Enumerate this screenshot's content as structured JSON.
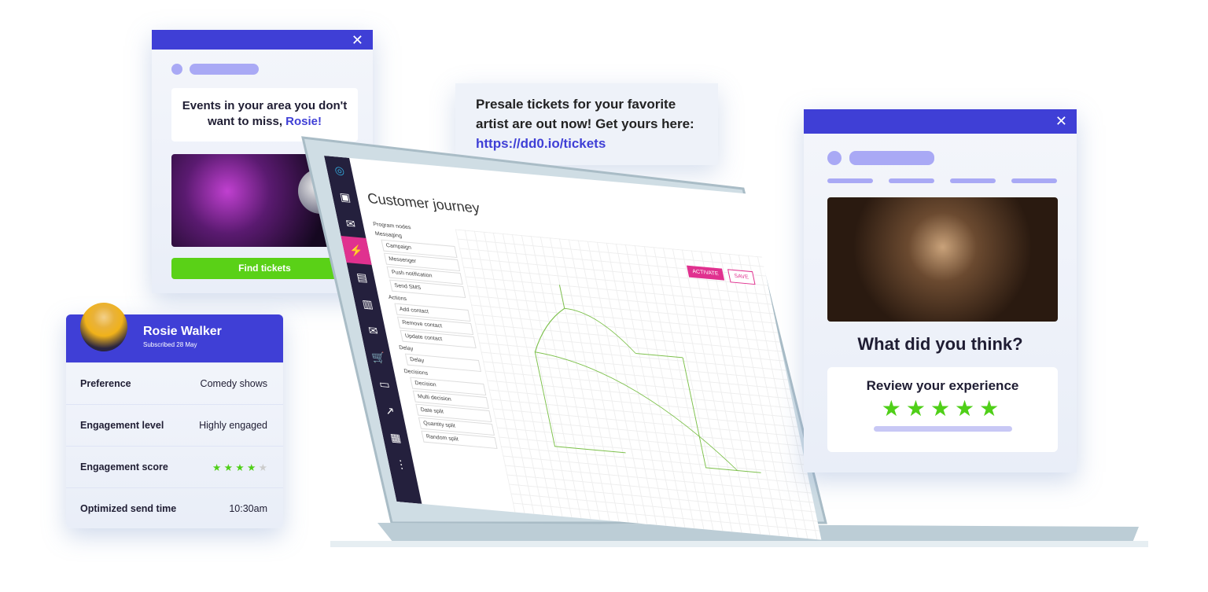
{
  "popup": {
    "message_line1": "Events in your area you don't",
    "message_line2": "want to miss, ",
    "name": "Rosie!",
    "button": "Find tickets",
    "close": "✕"
  },
  "sms": {
    "line1": "Presale tickets for your favorite",
    "line2": "artist are out now! Get yours here:",
    "link": "https://dd0.io/tickets"
  },
  "profile": {
    "name": "Rosie Walker",
    "subtitle": "Subscribed 28 May",
    "rows": [
      {
        "label": "Preference",
        "value": "Comedy shows"
      },
      {
        "label": "Engagement level",
        "value": "Highly engaged"
      },
      {
        "label": "Engagement score",
        "rating": 4,
        "max": 5
      },
      {
        "label": "Optimized send time",
        "value": "10:30am"
      }
    ]
  },
  "app": {
    "title": "Customer journey",
    "activate": "ACTIVATE",
    "save": "SAVE",
    "panel_title": "Program nodes",
    "groups": [
      {
        "name": "Messaging",
        "items": [
          "Campaign",
          "Messenger",
          "Push notification",
          "Send SMS"
        ]
      },
      {
        "name": "Actions",
        "items": [
          "Add contact",
          "Remove contact",
          "Update contact"
        ]
      },
      {
        "name": "Delay",
        "items": [
          "Delay"
        ]
      },
      {
        "name": "Decisions",
        "items": [
          "Decision",
          "Multi decision",
          "Date split",
          "Quantity split",
          "Random split"
        ]
      }
    ],
    "accent": "#e0318f"
  },
  "review": {
    "question": "What did you think?",
    "prompt": "Review your experience",
    "stars": 5,
    "close": "✕"
  },
  "colors": {
    "brand": "#3f3fd6",
    "green": "#4fcf18"
  }
}
